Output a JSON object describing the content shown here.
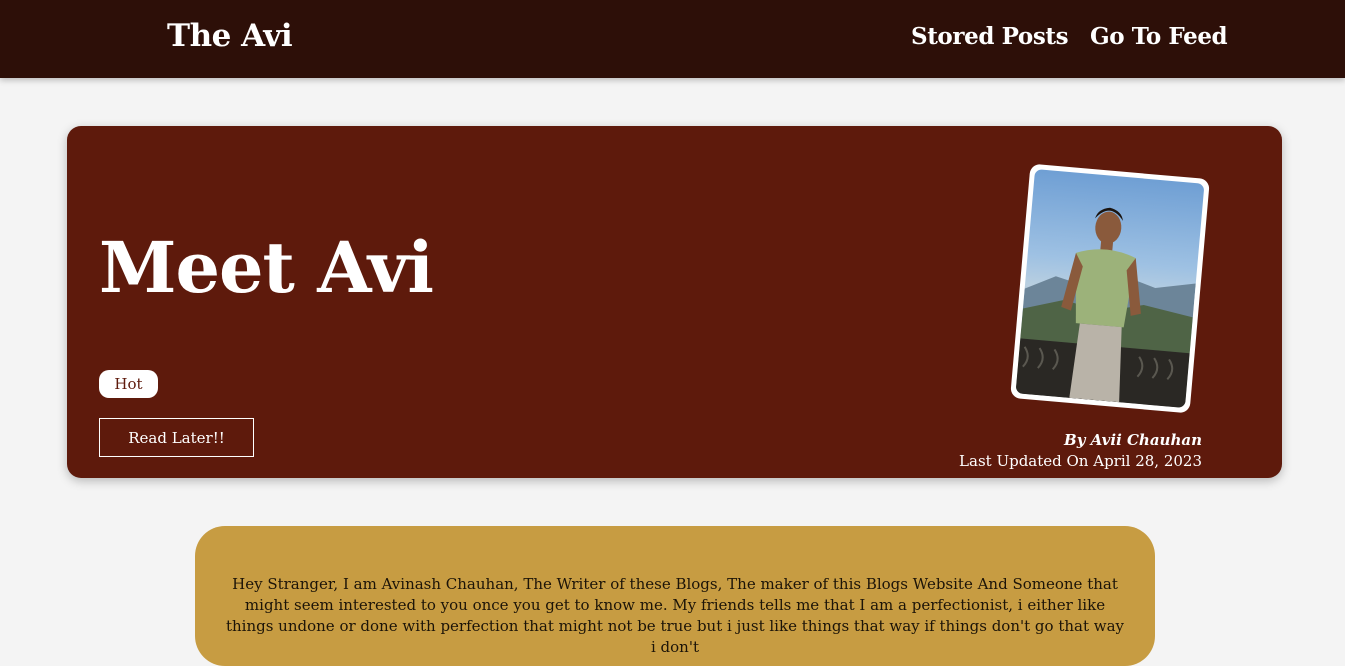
{
  "navbar": {
    "brand": "The Avi",
    "links": [
      "Stored Posts",
      "Go To Feed"
    ]
  },
  "hero": {
    "title": "Meet Avi",
    "tag": "Hot",
    "read_later_label": "Read Later!!",
    "byline": "By Avii Chauhan",
    "last_updated": "Last Updated On April 28, 2023",
    "photo": "author-photo"
  },
  "about": {
    "text": "Hey Stranger, I am Avinash Chauhan, The Writer of these Blogs, The maker of this Blogs Website And Someone that might seem interested to you once you get to know me. My friends tells me that I am a perfectionist, i either like things undone or done with perfection that might not be true but i just like things that way if things don't go that way i don't"
  },
  "colors": {
    "navbar_bg": "#2d0f08",
    "hero_bg": "#5e1a0c",
    "about_bg": "#c79c42",
    "page_bg": "#f4f4f4"
  }
}
